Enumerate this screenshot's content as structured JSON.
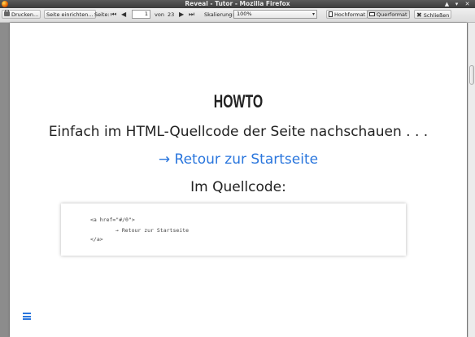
{
  "window": {
    "title": "Reveal - Tutor - Mozilla Firefox",
    "controls": {
      "up": "▲",
      "minimize": "▾",
      "close": "✕"
    }
  },
  "toolbar": {
    "print_label": "Drucken...",
    "page_setup_label": "Seite einrichten...",
    "page_label": "Seite:",
    "first_glyph": "⏮",
    "prev_glyph": "◀",
    "page_current": "1",
    "page_of_label": "von",
    "page_total": "23",
    "next_glyph": "▶",
    "last_glyph": "⏭",
    "scale_label": "Skalierung:",
    "scale_value": "100%",
    "scale_arrow": "▾",
    "portrait_label": "Hochformat",
    "landscape_label": "Querformat",
    "close_label": "Schließen",
    "close_glyph": "✖"
  },
  "slide": {
    "heading": "HOWTO",
    "text": "Einfach im HTML-Quellcode der Seite nachschauen . . .",
    "link": "→ Retour zur Startseite",
    "subheading": "Im Quellcode:",
    "code": {
      "line1": "<a href=\"#/0\">",
      "line2": "→ Retour zur Startseite",
      "line3": "</a>"
    }
  },
  "icons": {
    "app": "firefox-icon",
    "menu": "hamburger-menu-icon"
  },
  "colors": {
    "link": "#2a76dd",
    "menu_icon": "#2a76dd",
    "text": "#222222"
  }
}
